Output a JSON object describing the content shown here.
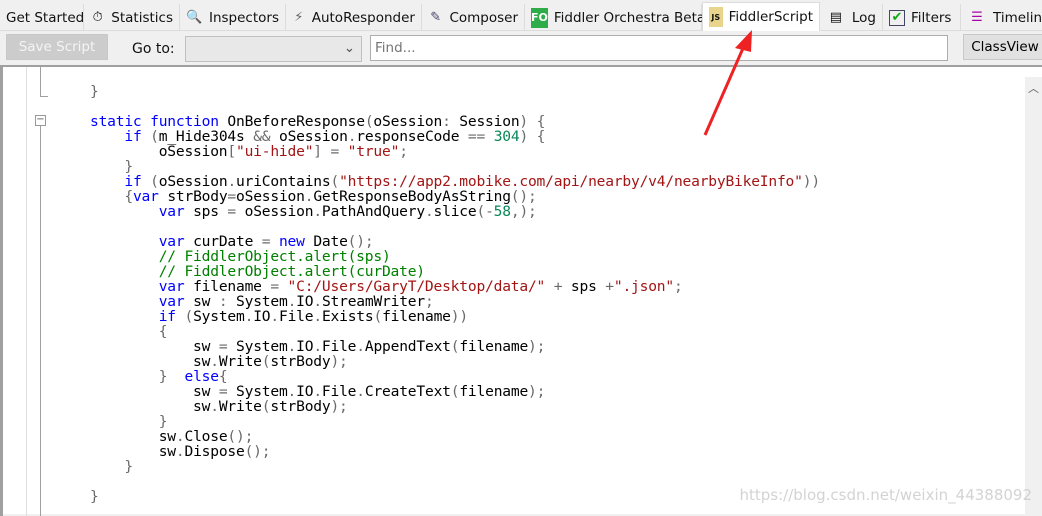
{
  "tabs": [
    {
      "label": "Get Started",
      "icon": ""
    },
    {
      "label": "Statistics",
      "icon": "stopwatch-icon"
    },
    {
      "label": "Inspectors",
      "icon": "magnifier-icon"
    },
    {
      "label": "AutoResponder",
      "icon": "lightning-icon"
    },
    {
      "label": "Composer",
      "icon": "pencil-note-icon"
    },
    {
      "label": "Fiddler Orchestra Beta",
      "icon": "fo-icon",
      "icon_text": "FO"
    },
    {
      "label": "FiddlerScript",
      "icon": "js-script-icon",
      "icon_text": "JS",
      "active": true
    },
    {
      "label": "Log",
      "icon": "log-icon"
    },
    {
      "label": "Filters",
      "icon": "checkbox-icon"
    },
    {
      "label": "Timeline",
      "icon": "timeline-icon"
    }
  ],
  "toolbar": {
    "save_label": "Save Script",
    "goto_label": "Go to:",
    "goto_value": "",
    "find_placeholder": "Find...",
    "classview_label": "ClassView"
  },
  "code_lines": [
    "",
    "}",
    "",
    "static function OnBeforeResponse(oSession: Session) {",
    "    if (m_Hide304s && oSession.responseCode == 304) {",
    "        oSession[\"ui-hide\"] = \"true\";",
    "    }",
    "    if (oSession.uriContains(\"https://app2.mobike.com/api/nearby/v4/nearbyBikeInfo\"))",
    "    {var strBody=oSession.GetResponseBodyAsString();",
    "        var sps = oSession.PathAndQuery.slice(-58,);",
    "",
    "        var curDate = new Date();",
    "        // FiddlerObject.alert(sps)",
    "        // FiddlerObject.alert(curDate)",
    "        var filename = \"C:/Users/GaryT/Desktop/data/\" + sps +\".json\";",
    "        var sw : System.IO.StreamWriter;",
    "        if (System.IO.File.Exists(filename))",
    "        {",
    "            sw = System.IO.File.AppendText(filename);",
    "            sw.Write(strBody);",
    "        }  else{",
    "            sw = System.IO.File.CreateText(filename);",
    "            sw.Write(strBody);",
    "        }",
    "        sw.Close();",
    "        sw.Dispose();",
    "    }",
    "",
    "}"
  ],
  "watermark": "https://blog.csdn.net/weixin_44388092",
  "colors": {
    "keyword": "#0000ff",
    "string": "#a31515",
    "comment": "#008000",
    "number": "#098658",
    "annotation_arrow": "#ee2222"
  }
}
